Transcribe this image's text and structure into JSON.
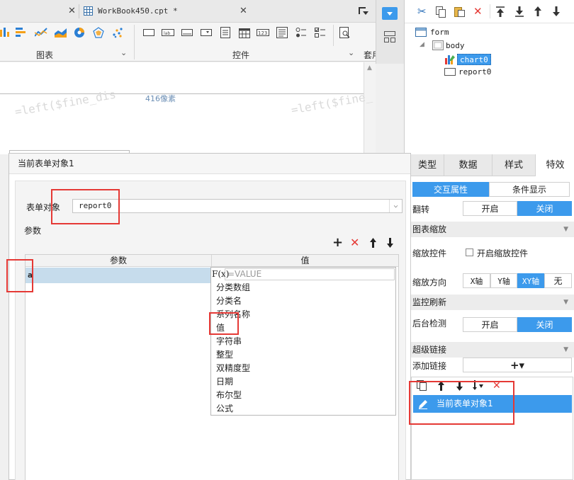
{
  "tabs": {
    "tab1_close": "✕",
    "tab2_title": "WorkBook450.cpt *",
    "tab2_close": "✕"
  },
  "toolbar": {
    "chart_group": "图表",
    "widget_group": "控件",
    "report_group": "套用"
  },
  "canvas": {
    "watermark1": "=left($fine_dis",
    "watermark2": "=left($fine_",
    "size_label": "416像素"
  },
  "tree": {
    "nodes": [
      "form",
      "body",
      "chart0",
      "report0"
    ]
  },
  "dialog": {
    "title": "当前表单对象1",
    "object_label": "表单对象",
    "object_value": "report0",
    "params_label": "参数",
    "col_param": "参数",
    "col_value": "值",
    "row_param": "a",
    "fx_label": "F(x)",
    "fx_placeholder": "=VALUE",
    "type_options": [
      "分类数组",
      "分类名",
      "系列名称",
      "值",
      "字符串",
      "整型",
      "双精度型",
      "日期",
      "布尔型",
      "公式"
    ]
  },
  "props": {
    "tabs": [
      "类型",
      "数据",
      "样式",
      "特效"
    ],
    "subtabs": [
      "交互属性",
      "条件显示"
    ],
    "flip_label": "翻转",
    "on_label": "开启",
    "off_label": "关闭",
    "zoom_section": "图表缩放",
    "zoom_widget_label": "缩放控件",
    "zoom_widget_check": "开启缩放控件",
    "zoom_dir_label": "缩放方向",
    "zoom_dirs": [
      "X轴",
      "Y轴",
      "XY轴",
      "无"
    ],
    "monitor_section": "监控刷新",
    "bg_check_label": "后台检测",
    "bg_on": "开启",
    "bg_off": "关闭",
    "hyperlink_section": "超级链接",
    "add_link_label": "添加链接",
    "add_link_btn": "+▾",
    "link_item": "当前表单对象1"
  }
}
